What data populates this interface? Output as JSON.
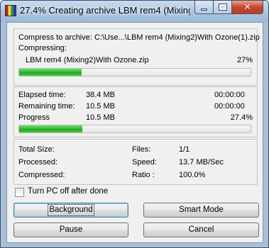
{
  "window": {
    "title": "27.4% Creating archive LBM rem4 (Mixing2)With Ozone(1).zip"
  },
  "archive": {
    "compress_to_label": "Compress to archive: C:\\Use...\\LBM rem4 (Mixing2)With Ozone(1).zip",
    "compressing_label": "Compressing:",
    "current_file": "LBM rem4 (Mixing2)With Ozone.zip",
    "file_percent": "27%",
    "file_progress": 0.27
  },
  "stats": {
    "elapsed_label": "Elapsed time:",
    "elapsed_size": "38.4 MB",
    "elapsed_time": "00:00:00",
    "remaining_label": "Remaining time:",
    "remaining_size": "10.5 MB",
    "remaining_time": "00:00:00",
    "progress_label": "Progress",
    "progress_size": "10.5 MB",
    "progress_percent": "27.4%",
    "overall_progress": 0.274
  },
  "summary": {
    "total_size_label": "Total Size:",
    "processed_label": "Processed:",
    "compressed_label": "Compressed:",
    "files_label": "Files:",
    "files_value": "1/1",
    "speed_label": "Speed:",
    "speed_value": "13.7 MB/Sec",
    "ratio_label": "Ratio :",
    "ratio_value": "100.0%"
  },
  "options": {
    "turn_off_label": "Turn PC off after done",
    "turn_off_checked": false
  },
  "buttons": {
    "background": "Background",
    "smart_mode": "Smart Mode",
    "pause": "Pause",
    "cancel": "Cancel"
  },
  "icons": {
    "app": "winrar-archive-icon",
    "minimize": "minimize-icon",
    "maximize": "maximize-icon",
    "close": "close-icon"
  },
  "colors": {
    "progress_fill": "#2fbf2f",
    "close_button": "#c9452c"
  }
}
